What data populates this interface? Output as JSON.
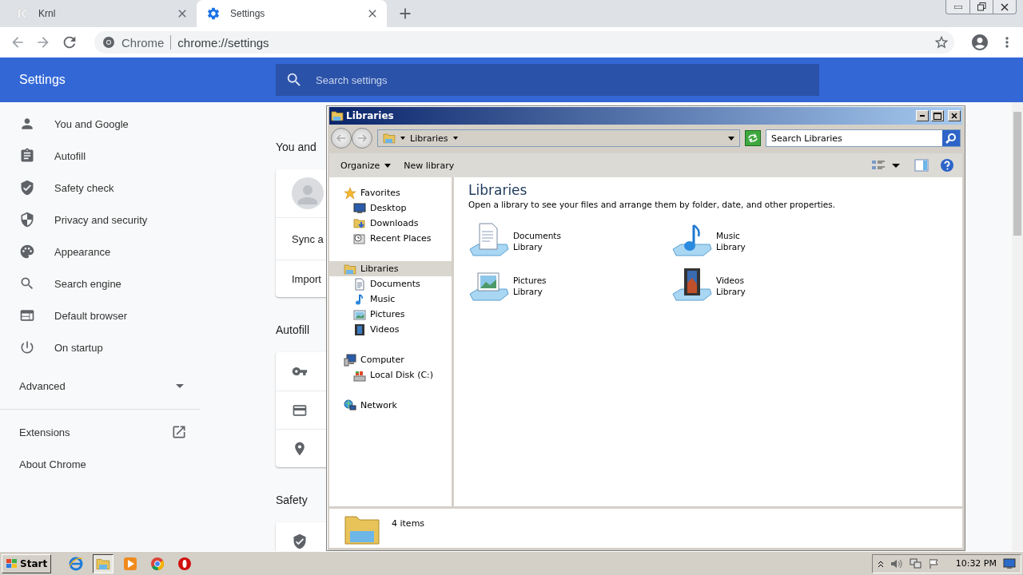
{
  "browser": {
    "tabs": [
      {
        "title": "Krnl",
        "kind": "krnl",
        "selected": false
      },
      {
        "title": "Settings",
        "kind": "settings",
        "selected": true
      }
    ],
    "omnibox": {
      "site": "Chrome",
      "url": "chrome://settings"
    }
  },
  "settings": {
    "title": "Settings",
    "search": {
      "placeholder": "Search settings"
    },
    "sidebar": {
      "items": [
        {
          "label": "You and Google",
          "kind": "person"
        },
        {
          "label": "Autofill",
          "kind": "clipboard"
        },
        {
          "label": "Safety check",
          "kind": "shield-check"
        },
        {
          "label": "Privacy and security",
          "kind": "shield"
        },
        {
          "label": "Appearance",
          "kind": "palette"
        },
        {
          "label": "Search engine",
          "kind": "search"
        },
        {
          "label": "Default browser",
          "kind": "browser"
        },
        {
          "label": "On startup",
          "kind": "power"
        }
      ],
      "advanced": {
        "label": "Advanced",
        "expanded": false
      },
      "links": [
        {
          "label": "Extensions",
          "kind": "external"
        },
        {
          "label": "About Chrome",
          "kind": "plain"
        }
      ]
    },
    "sections": [
      {
        "title": "You and",
        "rows": [
          {
            "kind": "avatar"
          },
          {
            "kind": "text",
            "label": "Sync a"
          },
          {
            "kind": "text",
            "label": "Import"
          }
        ]
      },
      {
        "title": "Autofill",
        "rows": [
          {
            "kind": "key"
          },
          {
            "kind": "card"
          },
          {
            "kind": "pin"
          }
        ]
      },
      {
        "title": "Safety",
        "rows": [
          {
            "kind": "shield"
          }
        ]
      }
    ]
  },
  "explorer": {
    "title": "Libraries",
    "address": "Libraries",
    "search": {
      "placeholder": "Search Libraries"
    },
    "commands": [
      {
        "label": "Organize",
        "menu": true
      },
      {
        "label": "New library",
        "menu": false
      }
    ],
    "nav": [
      {
        "label": "Favorites",
        "kind": "star",
        "selected": false,
        "children": [
          {
            "label": "Desktop",
            "kind": "desktop",
            "selected": false
          },
          {
            "label": "Downloads",
            "kind": "downloads",
            "selected": false
          },
          {
            "label": "Recent Places",
            "kind": "recent",
            "selected": false
          }
        ]
      },
      {
        "label": "Libraries",
        "kind": "library",
        "selected": true,
        "children": [
          {
            "label": "Documents",
            "kind": "document",
            "selected": false
          },
          {
            "label": "Music",
            "kind": "music",
            "selected": false
          },
          {
            "label": "Pictures",
            "kind": "picture",
            "selected": false
          },
          {
            "label": "Videos",
            "kind": "video",
            "selected": false
          }
        ]
      },
      {
        "label": "Computer",
        "kind": "computer",
        "selected": false,
        "children": [
          {
            "label": "Local Disk (C:)",
            "kind": "disk",
            "selected": false
          }
        ]
      },
      {
        "label": "Network",
        "kind": "network",
        "selected": false
      }
    ],
    "heading": "Libraries",
    "description": "Open a library to see your files and arrange them by folder, date, and other properties.",
    "libraries": [
      {
        "name": "Documents",
        "type": "Library",
        "kind": "document"
      },
      {
        "name": "Music",
        "type": "Library",
        "kind": "music"
      },
      {
        "name": "Pictures",
        "type": "Library",
        "kind": "picture"
      },
      {
        "name": "Videos",
        "type": "Library",
        "kind": "video"
      }
    ],
    "status": "4 items"
  },
  "taskbar": {
    "start": "Start",
    "apps": [
      {
        "kind": "ie",
        "selected": false
      },
      {
        "kind": "explorer",
        "selected": true
      },
      {
        "kind": "media",
        "selected": false
      },
      {
        "kind": "chrome",
        "selected": false
      },
      {
        "kind": "opera",
        "selected": false
      }
    ],
    "clock": "10:32 PM"
  }
}
